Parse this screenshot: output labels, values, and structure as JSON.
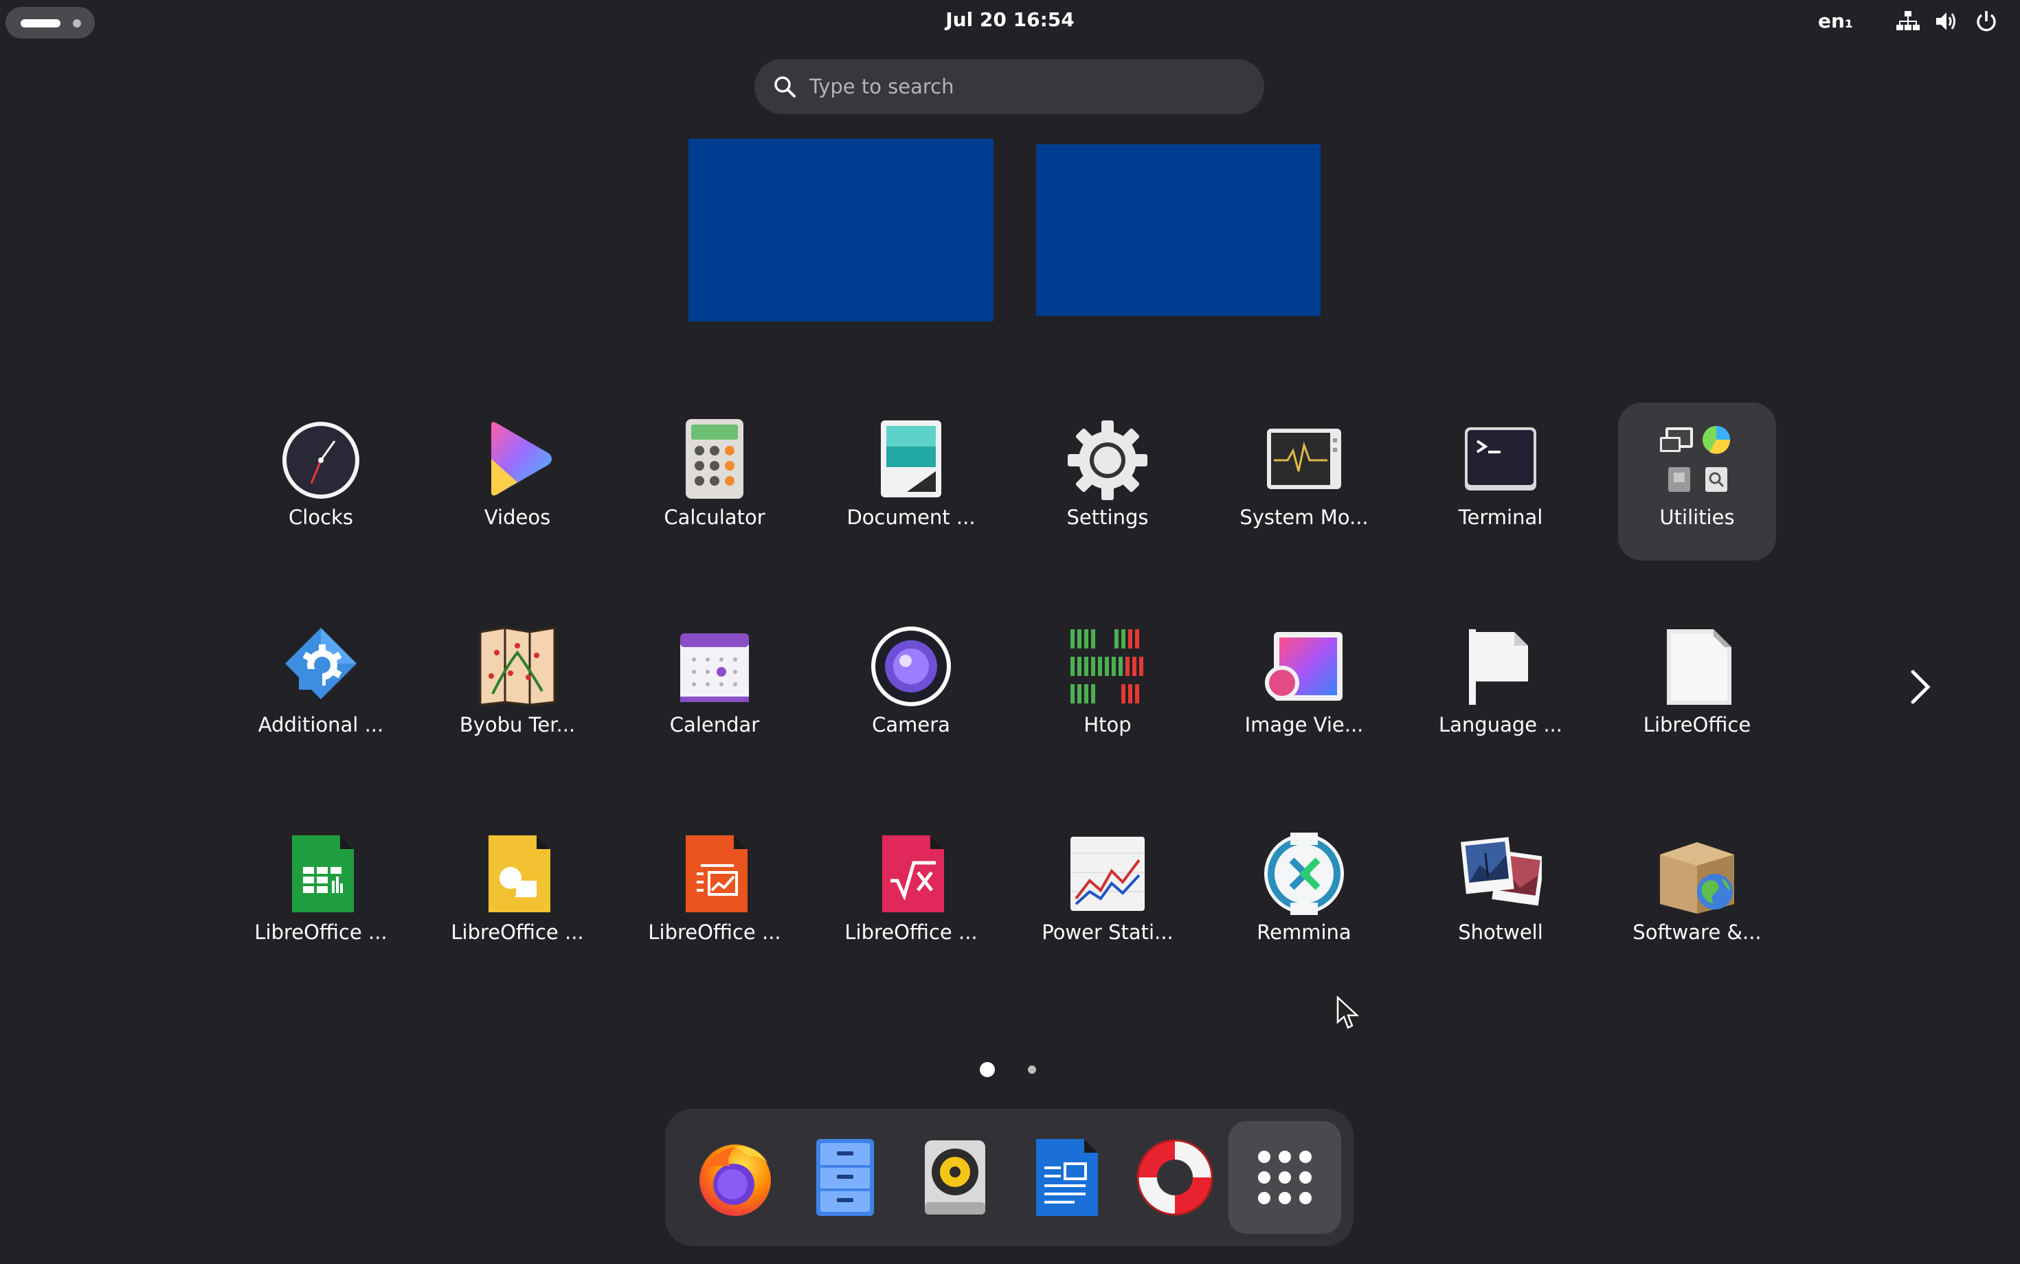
{
  "topbar": {
    "datetime": "Jul 20  16:54",
    "language": "en₁",
    "tray_icons": [
      "network-wired-icon",
      "volume-icon",
      "power-icon"
    ]
  },
  "search": {
    "placeholder": "Type to search",
    "value": ""
  },
  "workspaces": [
    "workspace-1",
    "workspace-2"
  ],
  "apps": {
    "row1": [
      "Clocks",
      "Videos",
      "Calculator",
      "Document ...",
      "Settings",
      "System Mo...",
      "Terminal",
      "Utilities"
    ],
    "row2": [
      "Additional ...",
      "Byobu Ter...",
      "Calendar",
      "Camera",
      "Htop",
      "Image Vie...",
      "Language ...",
      "LibreOffice"
    ],
    "row3": [
      "LibreOffice ...",
      "LibreOffice ...",
      "LibreOffice ...",
      "LibreOffice ...",
      "Power Stati...",
      "Remmina",
      "Shotwell",
      "Software &..."
    ]
  },
  "pager": {
    "pages": 2,
    "current": 1
  },
  "dock": [
    "firefox-icon",
    "files-icon",
    "rhythmbox-icon",
    "libreoffice-writer-icon",
    "help-icon",
    "show-apps-icon"
  ],
  "colors": {
    "background": "#222226",
    "workspace": "#003c8f",
    "search_bg": "#38383c",
    "dock_bg": "#323236"
  }
}
